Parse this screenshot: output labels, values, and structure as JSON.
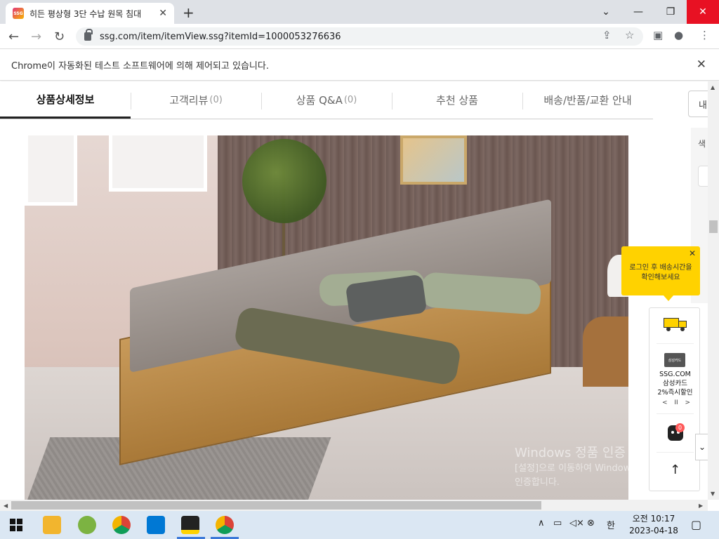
{
  "browser": {
    "tab_title": "히든 평상형 3단 수납 원목 침대",
    "favicon_text": "SSG",
    "url": "ssg.com/item/itemView.ssg?itemId=1000053276636",
    "infobar_text": "Chrome이 자동화된 테스트 소프트웨어에 의해 제어되고 있습니다."
  },
  "page": {
    "tabs": [
      {
        "label": "상품상세정보",
        "count": ""
      },
      {
        "label": "고객리뷰",
        "count": "(0)"
      },
      {
        "label": "상품 Q&A",
        "count": "(0)"
      },
      {
        "label": "추천 상품",
        "count": ""
      },
      {
        "label": "배송/반품/교환 안내",
        "count": ""
      }
    ],
    "right_box_text": "내",
    "right_panel_label": "색"
  },
  "widget": {
    "tooltip": "로그인 후 배송시간을 확인해보세요",
    "card_label": "삼성카드",
    "promo_line1": "SSG.COM",
    "promo_line2": "삼성카드",
    "promo_line3": "2%즉시할인",
    "promo_prev": "<",
    "promo_pause": "II",
    "promo_next": ">",
    "cart_count": "0",
    "top_arrow": "↑"
  },
  "watermark": {
    "line1": "Windows 정품 인증",
    "line2": "[설정]으로 이동하여 Windows를 정품",
    "line3": "인증합니다."
  },
  "taskbar": {
    "clock_period_time": "오전 10:17",
    "clock_date": "2023-04-18",
    "ime": "한"
  }
}
